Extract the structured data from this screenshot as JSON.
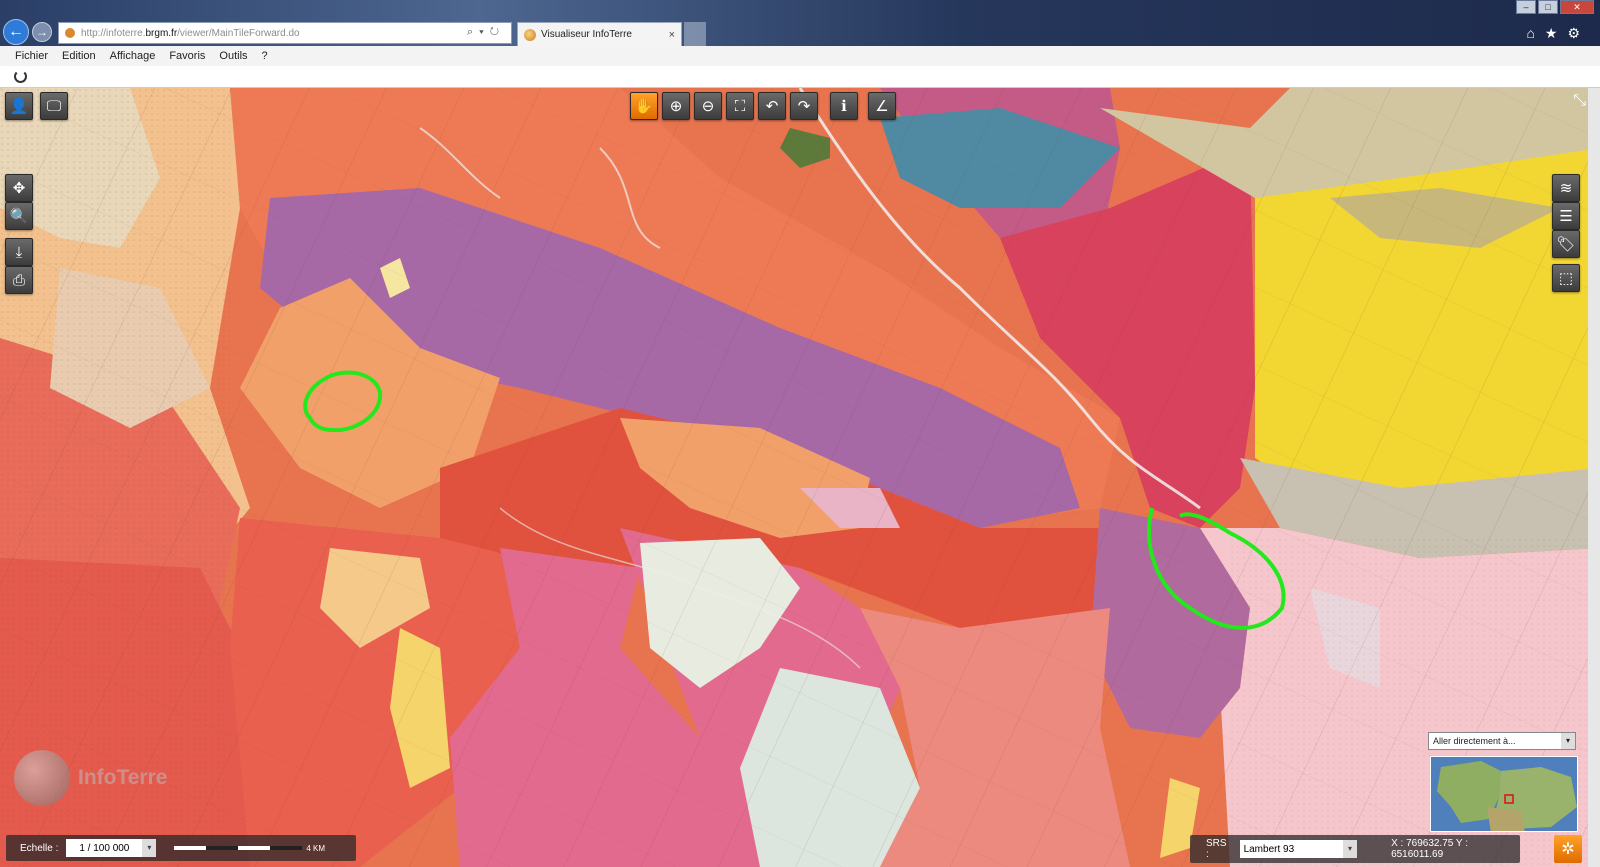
{
  "browser": {
    "url_prefix": "http://infoterre.",
    "url_domain": "brgm.fr",
    "url_path": "/viewer/MainTileForward.do",
    "tab_title": "Visualiseur InfoTerre",
    "tab_close": "×",
    "address_tools": "⌕▾↻",
    "back_glyph": "←",
    "forward_glyph": "→",
    "window_controls": {
      "minimize": "–",
      "maximize": "□",
      "close": "✕"
    },
    "toolbar_icons": "⌂★⚙"
  },
  "menu": {
    "items": [
      {
        "label": "Fichier"
      },
      {
        "label": "Edition"
      },
      {
        "label": "Affichage"
      },
      {
        "label": "Favoris"
      },
      {
        "label": "Outils"
      },
      {
        "label": "?"
      }
    ]
  },
  "map_tools": {
    "top": [
      {
        "name": "pan-icon",
        "glyph": "✋",
        "active": true
      },
      {
        "name": "zoom-in-icon",
        "glyph": "⊕"
      },
      {
        "name": "zoom-out-icon",
        "glyph": "⊖"
      },
      {
        "name": "zoom-extent-icon",
        "glyph": "⛶"
      },
      {
        "name": "undo-icon",
        "glyph": "↶"
      },
      {
        "name": "redo-icon",
        "glyph": "↷"
      },
      {
        "name": "info-icon",
        "glyph": "ℹ"
      },
      {
        "name": "measure-icon",
        "glyph": "∠"
      }
    ],
    "left_top": [
      {
        "name": "user-icon",
        "glyph": "👤"
      },
      {
        "name": "screen-icon",
        "glyph": "🖵"
      }
    ],
    "left": [
      {
        "name": "move-icon",
        "glyph": "✥"
      },
      {
        "name": "zoom-box-icon",
        "glyph": "🔍"
      },
      {
        "name": "download-icon",
        "glyph": "⤓"
      },
      {
        "name": "print-icon",
        "glyph": "⎙"
      }
    ],
    "right": [
      {
        "name": "layers-icon",
        "glyph": "≋"
      },
      {
        "name": "legend-icon",
        "glyph": "☰"
      },
      {
        "name": "tag-icon",
        "glyph": "🏷"
      },
      {
        "name": "extent-icon",
        "glyph": "⬚"
      }
    ],
    "collapse_glyph": "⤡"
  },
  "scale": {
    "label": "Echelle :",
    "value": "1 / 100 000",
    "dropdown_glyph": "▾",
    "ruler_label": "4 KM"
  },
  "srs": {
    "label": "SRS :",
    "value": "Lambert 93",
    "dropdown_glyph": "▾",
    "coords": "X : 769632.75 Y : 6516011.69"
  },
  "overview": {
    "goto_label": "Aller directement à...",
    "dropdown_glyph": "▾"
  },
  "logo_text": "InfoTerre",
  "settings_glyph": "✲",
  "colors": {
    "accent": "#f7931e",
    "annotation": "#22e81c",
    "toolbar_dark": "#4a4a4a"
  }
}
